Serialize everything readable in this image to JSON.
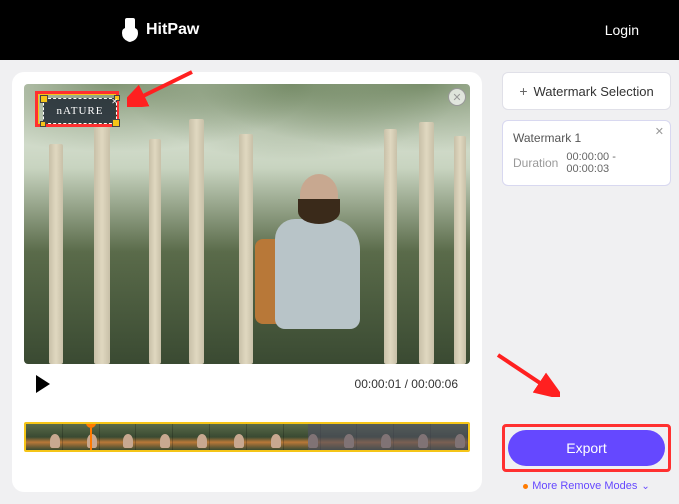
{
  "header": {
    "brand": "HitPaw",
    "login": "Login"
  },
  "video": {
    "watermark_text": "nATURE",
    "current_time": "00:00:01",
    "total_time": "00:00:06"
  },
  "sidebar": {
    "watermark_selection": "Watermark Selection",
    "card": {
      "title": "Watermark 1",
      "duration_label": "Duration",
      "duration_value": "00:00:00 - 00:00:03"
    },
    "export": "Export",
    "more_modes": "More Remove Modes"
  }
}
